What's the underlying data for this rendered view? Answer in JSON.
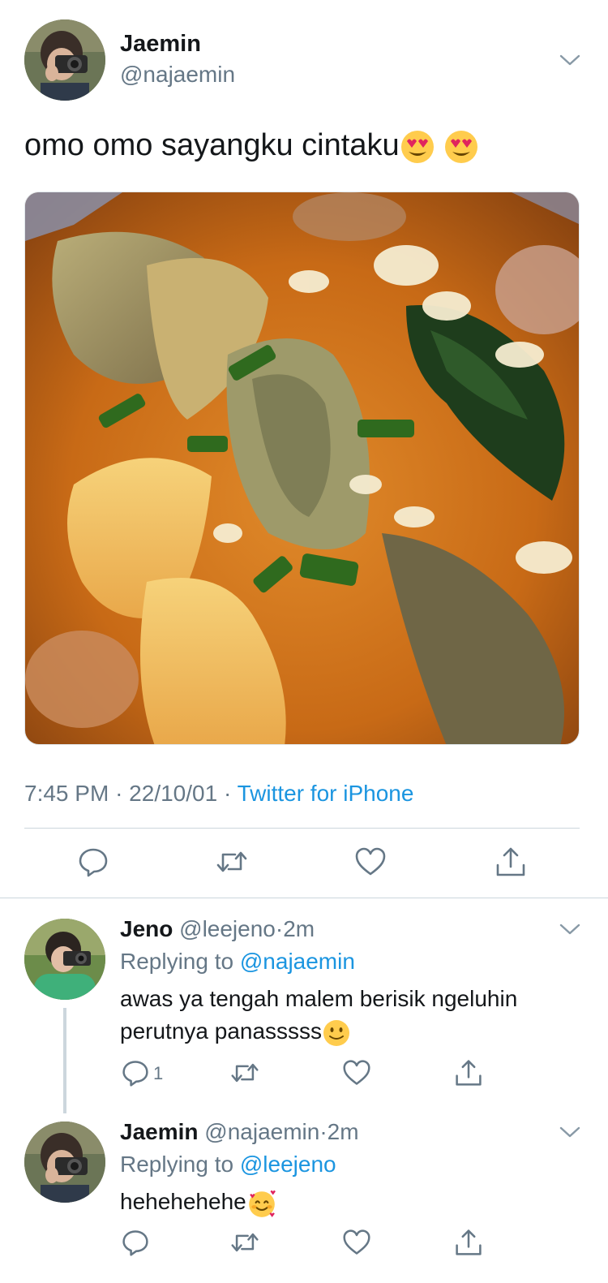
{
  "main_tweet": {
    "name": "Jaemin",
    "handle": "@najaemin",
    "text": "omo omo sayangku cintaku",
    "time": "7:45 PM",
    "date": "22/10/01",
    "dot": "·",
    "source": "Twitter for iPhone"
  },
  "replies": [
    {
      "name": "Jeno",
      "handle": "@leejeno",
      "age": "2m",
      "replying_label": "Replying to",
      "replying_to": "@najaemin",
      "text_line1": "awas ya tengah malem berisik ngeluhin",
      "text_line2": "perutnya panasssss",
      "reply_count": "1"
    },
    {
      "name": "Jaemin",
      "handle": "@najaemin",
      "age": "2m",
      "replying_label": "Replying to",
      "replying_to": "@leejeno",
      "text_line1": "hehehehehe",
      "reply_count": ""
    }
  ],
  "icons": {
    "reply": "reply-icon",
    "retweet": "retweet-icon",
    "like": "heart-icon",
    "share": "share-icon",
    "more": "chevron-down-icon"
  },
  "colors": {
    "link": "#1b95e0",
    "secondary": "#657786",
    "primary": "#14171a",
    "divider": "#ccd6dd"
  }
}
